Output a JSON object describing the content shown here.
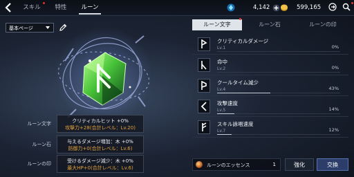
{
  "header": {
    "tabs": [
      {
        "label": "スキル",
        "active": false,
        "alert": true
      },
      {
        "label": "特性",
        "active": false,
        "alert": false
      },
      {
        "label": "ルーン",
        "active": true,
        "alert": false
      }
    ],
    "currency": [
      {
        "icon": "crystal-icon",
        "value": "4,142"
      },
      {
        "icon": "gold-coin-icon",
        "value": "599,165"
      }
    ]
  },
  "page_select": {
    "value": "基本ページ"
  },
  "stats": [
    {
      "label": "ルーン文字",
      "line1": "クリティカルヒット +0%",
      "line2": "攻撃力+28(合計レベル：Lv.20)"
    },
    {
      "label": "ルーン石",
      "line1": "与えるダメージ増加：木 +0%",
      "line2": "防御力+0(合計レベル：Lv.6)"
    },
    {
      "label": "ルーンの印",
      "line1": "受けるダメージ減少：木 +0%",
      "line2": "最大HP+0(合計レベル：Lv.6)"
    }
  ],
  "right_tabs": [
    "ルーン文字",
    "ルーン石",
    "ルーンの印"
  ],
  "runes": [
    {
      "name": "クリティカルダメージ",
      "level": "Lv.1",
      "percent": "0%",
      "progress": 0
    },
    {
      "name": "命中",
      "level": "Lv.2",
      "percent": "0%",
      "progress": 0
    },
    {
      "name": "クールタイム減少",
      "level": "Lv.4",
      "percent": "43%",
      "progress": 0.43
    },
    {
      "name": "攻撃速度",
      "level": "Lv.5",
      "percent": "14%",
      "progress": 0.14
    },
    {
      "name": "スキル詠唱速度",
      "level": "Lv.7",
      "percent": "12%",
      "progress": 0.12
    }
  ],
  "essence": {
    "label": "ルーンのエッセンス",
    "count": "1"
  },
  "buttons": {
    "enhance": "強化",
    "exchange": "交換"
  },
  "colors": {
    "accent_orange": "#e5a23a",
    "rune_green": "#49c43a",
    "active_tab": "#dfe3ea"
  }
}
